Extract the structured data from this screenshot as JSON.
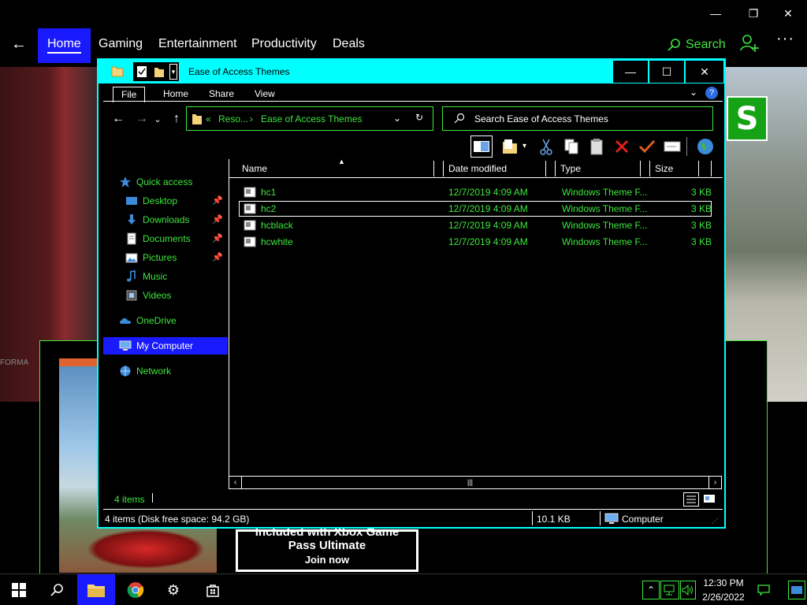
{
  "store": {
    "nav_tabs": [
      "Home",
      "Gaming",
      "Entertainment",
      "Productivity",
      "Deals"
    ],
    "active_tab": "Home",
    "search_label": "Search",
    "more_label": "···",
    "promo": {
      "line1": "Included with Xbox Game",
      "line2": "Pass Ultimate",
      "join": "Join now"
    },
    "hero_side_text": "FORMA"
  },
  "explorer": {
    "title": "Ease of Access Themes",
    "ribbon_tabs": [
      "File",
      "Home",
      "Share",
      "View"
    ],
    "address": {
      "chevron": "«",
      "crumb1": "Reso...",
      "sep": "›",
      "crumb2": "Ease of Access Themes"
    },
    "search_placeholder": "Search Ease of Access Themes",
    "nav": [
      {
        "label": "Quick access",
        "icon": "star-icon"
      },
      {
        "label": "Desktop",
        "icon": "desktop-icon",
        "pinned": true
      },
      {
        "label": "Downloads",
        "icon": "downloads-icon",
        "pinned": true
      },
      {
        "label": "Documents",
        "icon": "documents-icon",
        "pinned": true
      },
      {
        "label": "Pictures",
        "icon": "pictures-icon",
        "pinned": true
      },
      {
        "label": "Music",
        "icon": "music-icon"
      },
      {
        "label": "Videos",
        "icon": "videos-icon"
      },
      {
        "label": "OneDrive",
        "icon": "onedrive-icon"
      },
      {
        "label": "My Computer",
        "icon": "computer-icon",
        "selected": true
      },
      {
        "label": "Network",
        "icon": "network-icon"
      }
    ],
    "columns": [
      "Name",
      "Date modified",
      "Type",
      "Size"
    ],
    "files": [
      {
        "name": "hc1",
        "date": "12/7/2019 4:09 AM",
        "type": "Windows Theme F...",
        "size": "3 KB"
      },
      {
        "name": "hc2",
        "date": "12/7/2019 4:09 AM",
        "type": "Windows Theme F...",
        "size": "3 KB",
        "selected": true
      },
      {
        "name": "hcblack",
        "date": "12/7/2019 4:09 AM",
        "type": "Windows Theme F...",
        "size": "3 KB"
      },
      {
        "name": "hcwhite",
        "date": "12/7/2019 4:09 AM",
        "type": "Windows Theme F...",
        "size": "3 KB"
      }
    ],
    "item_count": "4 items",
    "status": {
      "items": "4 items (Disk free space: 94.2 GB)",
      "size": "10.1 KB",
      "location": "Computer"
    }
  },
  "taskbar": {
    "time": "12:30 PM",
    "date": "2/26/2022"
  },
  "colors": {
    "accent_green": "#3ee63e",
    "title_cyan": "#00ffff",
    "selection_blue": "#1a1aff"
  }
}
